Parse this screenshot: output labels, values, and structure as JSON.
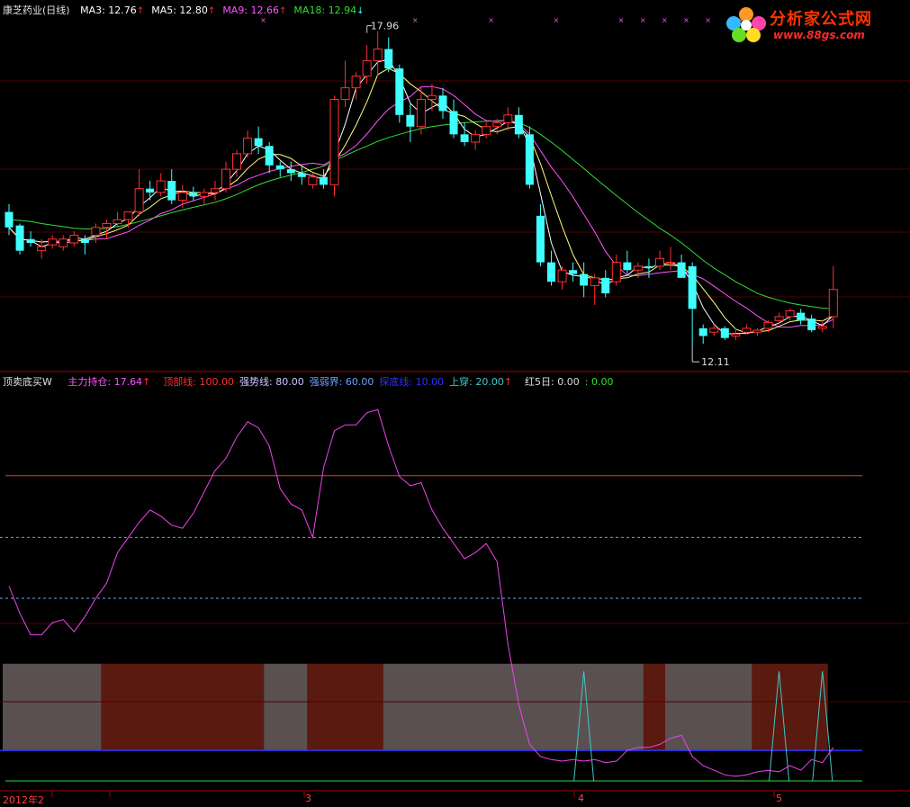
{
  "top_panel": {
    "stock_name": "康芝药业(日线)",
    "ma": [
      {
        "label": "MA3: 12.76",
        "color": "#ffffff",
        "arrow": "↑",
        "arrow_color": "#ff3030"
      },
      {
        "label": "MA5: 12.80",
        "color": "#ffffff",
        "arrow": "↑",
        "arrow_color": "#ff3030"
      },
      {
        "label": "MA9: 12.66",
        "color": "#ff55ff",
        "arrow": "↑",
        "arrow_color": "#ff3030"
      },
      {
        "label": "MA18: 12.94",
        "color": "#33dd33",
        "arrow": "↓",
        "arrow_color": "#40ffff"
      }
    ],
    "high_label": "17.96",
    "low_label": "12.11"
  },
  "bottom_panel": {
    "indicator_name": "顶卖底买W",
    "items": [
      {
        "label": "主力持仓: 17.64",
        "color": "#ff55ff",
        "arrow": "↑"
      },
      {
        "label": "顶部线: 100.00",
        "color": "#ff3030",
        "arrow": ""
      },
      {
        "label": "强势线: 80.00",
        "color": "#c8c8ff",
        "arrow": ""
      },
      {
        "label": "强弱界: 60.00",
        "color": "#6f9fff",
        "arrow": ""
      },
      {
        "label": "探底线: 10.00",
        "color": "#3030ff",
        "arrow": ""
      },
      {
        "label": "上穿: 20.00",
        "color": "#40c8c8",
        "arrow": "↑"
      },
      {
        "label": "红5日: 0.00",
        "color": "#dddddd",
        "arrow": ""
      },
      {
        "label": ": 0.00",
        "color": "#33dd33",
        "arrow": ""
      }
    ]
  },
  "watermark": {
    "title": "分析家公式网",
    "url": "www.88gs.com"
  },
  "date_axis": [
    {
      "label": "2012年2",
      "pos": "start"
    },
    {
      "label": "3",
      "pos": "mar"
    },
    {
      "label": "4",
      "pos": "apr"
    },
    {
      "label": "5",
      "pos": "may"
    }
  ],
  "colors": {
    "up": "#ff3030",
    "down": "#40ffff",
    "ma3": "#ffffff",
    "ma5": "#ffff80",
    "ma9": "#ff55ff",
    "ma18": "#33dd33",
    "frame": "#aa0000",
    "band_red": "#5a1a10",
    "band_gray": "#5a5050"
  },
  "chart_data": {
    "type": "candlestick",
    "price_candles": [
      [
        13.3,
        13.5,
        12.7,
        12.9
      ],
      [
        12.95,
        13.0,
        12.2,
        12.3
      ],
      [
        12.6,
        12.8,
        12.4,
        12.5
      ],
      [
        12.3,
        12.6,
        12.1,
        12.4
      ],
      [
        12.45,
        12.7,
        12.35,
        12.6
      ],
      [
        12.4,
        12.7,
        12.3,
        12.6
      ],
      [
        12.5,
        12.8,
        12.4,
        12.7
      ],
      [
        12.6,
        12.7,
        12.2,
        12.5
      ],
      [
        12.7,
        13.0,
        12.5,
        12.9
      ],
      [
        12.9,
        13.1,
        12.6,
        13.0
      ],
      [
        13.0,
        13.3,
        12.9,
        13.1
      ],
      [
        13.1,
        13.3,
        12.9,
        13.3
      ],
      [
        13.3,
        14.4,
        13.2,
        13.9
      ],
      [
        13.9,
        14.1,
        13.6,
        13.8
      ],
      [
        13.8,
        14.3,
        13.7,
        14.1
      ],
      [
        14.1,
        14.4,
        13.5,
        13.6
      ],
      [
        13.6,
        14.0,
        13.4,
        13.8
      ],
      [
        13.8,
        13.95,
        13.6,
        13.7
      ],
      [
        13.7,
        13.9,
        13.5,
        13.8
      ],
      [
        13.8,
        14.1,
        13.6,
        13.9
      ],
      [
        13.9,
        14.6,
        13.8,
        14.4
      ],
      [
        14.4,
        14.9,
        14.2,
        14.8
      ],
      [
        14.8,
        15.4,
        14.7,
        15.2
      ],
      [
        15.2,
        15.5,
        14.8,
        15.0
      ],
      [
        15.0,
        15.1,
        14.3,
        14.5
      ],
      [
        14.5,
        14.6,
        14.2,
        14.4
      ],
      [
        14.4,
        14.6,
        14.1,
        14.3
      ],
      [
        14.3,
        14.5,
        14.0,
        14.2
      ],
      [
        14.0,
        14.3,
        13.9,
        14.2
      ],
      [
        14.2,
        14.4,
        13.9,
        14.0
      ],
      [
        14.0,
        16.3,
        13.7,
        16.2
      ],
      [
        16.2,
        17.2,
        16.0,
        16.5
      ],
      [
        16.5,
        16.9,
        16.2,
        16.8
      ],
      [
        16.8,
        17.6,
        16.6,
        17.2
      ],
      [
        17.2,
        17.96,
        16.8,
        17.5
      ],
      [
        17.5,
        17.8,
        16.9,
        17.0
      ],
      [
        17.0,
        17.1,
        15.6,
        15.8
      ],
      [
        15.8,
        16.1,
        15.1,
        15.5
      ],
      [
        15.5,
        16.5,
        15.3,
        16.2
      ],
      [
        16.2,
        16.6,
        15.9,
        16.3
      ],
      [
        16.3,
        16.5,
        15.7,
        15.9
      ],
      [
        15.9,
        16.2,
        15.2,
        15.3
      ],
      [
        15.3,
        15.6,
        15.0,
        15.1
      ],
      [
        15.1,
        15.4,
        14.9,
        15.3
      ],
      [
        15.3,
        15.6,
        15.2,
        15.5
      ],
      [
        15.5,
        15.7,
        15.3,
        15.6
      ],
      [
        15.6,
        16.0,
        15.4,
        15.8
      ],
      [
        15.8,
        16.0,
        15.2,
        15.3
      ],
      [
        15.3,
        15.5,
        13.9,
        14.0
      ],
      [
        13.2,
        13.5,
        11.9,
        12.0
      ],
      [
        12.0,
        12.3,
        11.4,
        11.5
      ],
      [
        11.5,
        11.9,
        11.3,
        11.8
      ],
      [
        11.8,
        12.0,
        11.5,
        11.7
      ],
      [
        11.7,
        12.0,
        11.1,
        11.4
      ],
      [
        11.4,
        11.7,
        10.9,
        11.6
      ],
      [
        11.6,
        11.8,
        11.1,
        11.2
      ],
      [
        11.5,
        12.2,
        11.4,
        12.0
      ],
      [
        12.0,
        12.3,
        11.7,
        11.8
      ],
      [
        11.8,
        12.0,
        11.6,
        11.9
      ],
      [
        11.9,
        12.1,
        11.6,
        11.85
      ],
      [
        11.9,
        12.3,
        11.8,
        12.1
      ],
      [
        12.0,
        12.4,
        11.8,
        12.0
      ],
      [
        12.0,
        12.2,
        11.7,
        11.6
      ],
      [
        11.9,
        12.0,
        9.9,
        10.8
      ],
      [
        10.3,
        10.4,
        9.9,
        10.1
      ],
      [
        10.2,
        10.4,
        10.1,
        10.3
      ],
      [
        10.3,
        10.35,
        10.0,
        10.05
      ],
      [
        10.1,
        10.3,
        10.0,
        10.15
      ],
      [
        10.2,
        10.4,
        10.15,
        10.3
      ],
      [
        10.2,
        10.3,
        10.1,
        10.25
      ],
      [
        10.3,
        10.5,
        10.2,
        10.45
      ],
      [
        10.5,
        10.7,
        10.4,
        10.6
      ],
      [
        10.6,
        10.8,
        10.5,
        10.75
      ],
      [
        10.7,
        10.8,
        10.4,
        10.5
      ],
      [
        10.55,
        10.65,
        10.2,
        10.25
      ],
      [
        10.3,
        10.5,
        10.2,
        10.35
      ],
      [
        10.6,
        11.9,
        10.3,
        11.3
      ]
    ],
    "ma18": [
      13.1,
      13.08,
      13.05,
      13.0,
      12.96,
      12.92,
      12.88,
      12.86,
      12.86,
      12.88,
      12.92,
      12.98,
      13.05,
      13.12,
      13.2,
      13.28,
      13.35,
      13.42,
      13.48,
      13.55,
      13.64,
      13.75,
      13.88,
      14.0,
      14.1,
      14.18,
      14.25,
      14.32,
      14.4,
      14.48,
      14.62,
      14.75,
      14.88,
      15.0,
      15.12,
      15.22,
      15.3,
      15.38,
      15.45,
      15.5,
      15.54,
      15.57,
      15.6,
      15.62,
      15.64,
      15.65,
      15.66,
      15.6,
      15.48,
      15.3,
      15.1,
      14.88,
      14.65,
      14.42,
      14.18,
      13.95,
      13.72,
      13.5,
      13.28,
      13.08,
      12.88,
      12.7,
      12.5,
      12.28,
      12.05,
      11.85,
      11.68,
      11.5,
      11.35,
      11.2,
      11.1,
      11.02,
      10.95,
      10.9,
      10.86,
      10.82,
      10.8
    ],
    "indicator_zhulichicang": [
      64,
      55,
      48,
      48,
      52,
      53,
      49,
      54,
      60,
      65,
      75,
      80,
      85,
      89,
      87,
      84,
      83,
      88,
      95,
      102,
      106,
      113,
      118,
      116,
      110,
      96,
      91,
      89,
      80,
      103,
      115,
      117,
      117,
      121,
      122,
      110,
      100,
      97,
      98,
      89,
      83,
      78,
      73,
      75,
      78,
      72,
      45,
      25,
      12,
      8,
      7,
      6.5,
      7,
      6.5,
      7,
      6,
      6.5,
      10,
      11,
      11,
      12,
      14,
      15,
      8,
      5,
      3.5,
      2,
      1.5,
      2,
      3,
      3.5,
      3,
      5,
      3.5,
      7,
      6,
      11
    ],
    "reference_lines": {
      "top_line": 100,
      "strong_line": 80,
      "strong_weak_line": 60,
      "bottom_line": 10
    },
    "bands": [
      {
        "from": 0,
        "to": 9,
        "color": "gray"
      },
      {
        "from": 9,
        "to": 24,
        "color": "red"
      },
      {
        "from": 24,
        "to": 28,
        "color": "gray"
      },
      {
        "from": 28,
        "to": 35,
        "color": "red"
      },
      {
        "from": 35,
        "to": 59,
        "color": "gray"
      },
      {
        "from": 59,
        "to": 61,
        "color": "red"
      },
      {
        "from": 61,
        "to": 69,
        "color": "gray"
      },
      {
        "from": 69,
        "to": 76,
        "color": "red"
      }
    ],
    "cross_spikes": [
      53,
      71,
      75
    ],
    "price_range": [
      9.3,
      18.3
    ],
    "indicator_range": [
      0,
      128
    ]
  }
}
